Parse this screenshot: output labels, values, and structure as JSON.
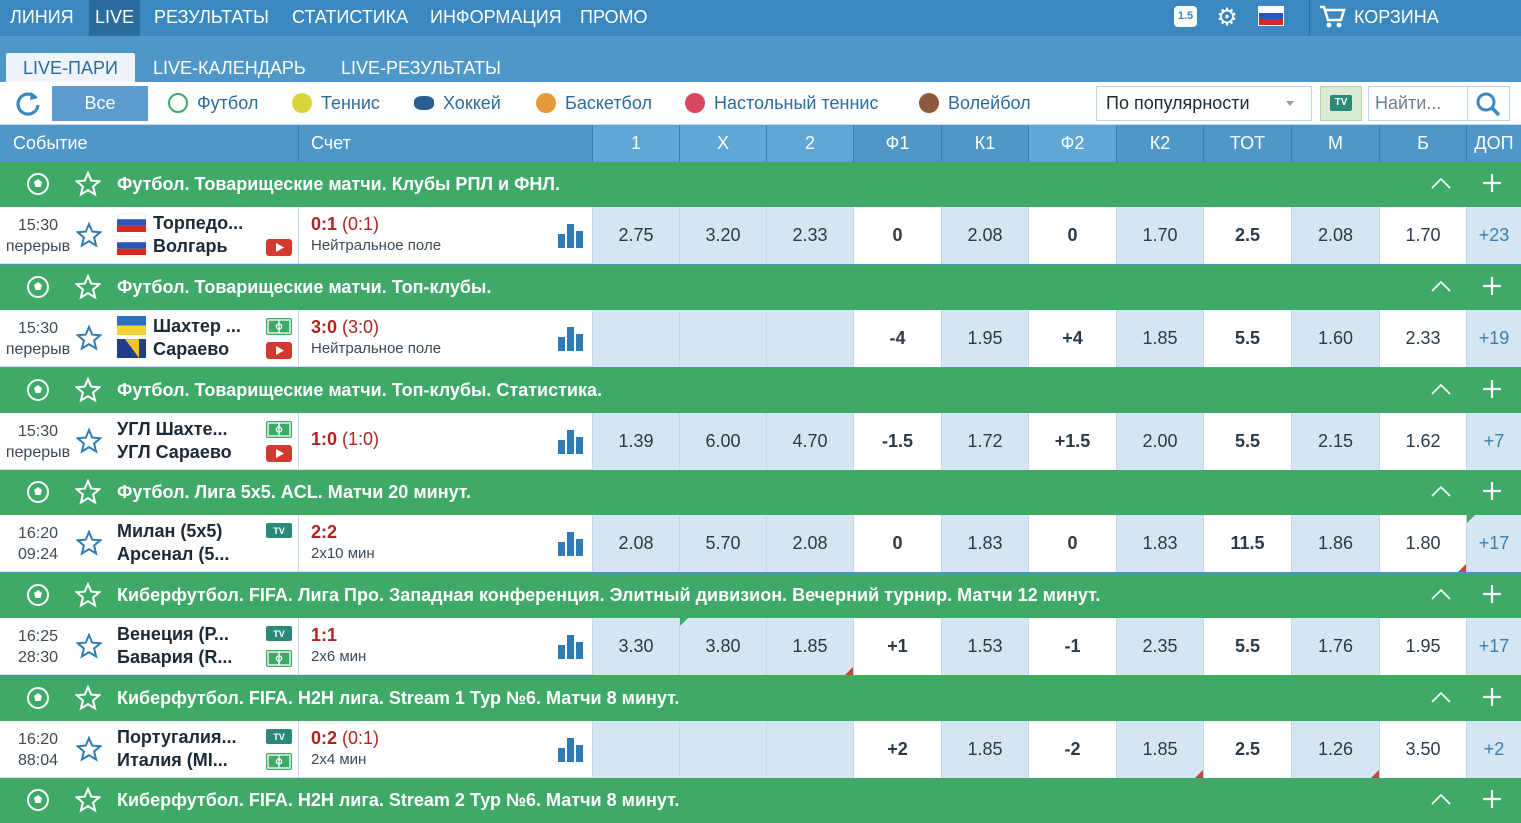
{
  "topnav": {
    "items": [
      "ЛИНИЯ",
      "LIVE",
      "РЕЗУЛЬТАТЫ",
      "СТАТИСТИКА",
      "ИНФОРМАЦИЯ",
      "ПРОМО"
    ],
    "active_index": 1,
    "version_badge": "1.5",
    "cart_label": "КОРЗИНА"
  },
  "subtabs": [
    "LIVE-ПАРИ",
    "LIVE-КАЛЕНДАРЬ",
    "LIVE-РЕЗУЛЬТАТЫ"
  ],
  "filters": {
    "all_label": "Все",
    "sports": [
      "Футбол",
      "Теннис",
      "Хоккей",
      "Баскетбол",
      "Настольный теннис",
      "Волейбол"
    ],
    "sort_value": "По популярности",
    "tv_label": "TV",
    "search_placeholder": "Найти..."
  },
  "header": {
    "event": "Событие",
    "score": "Счет",
    "cols": [
      "1",
      "X",
      "2",
      "Ф1",
      "К1",
      "Ф2",
      "К2",
      "ТОТ",
      "М",
      "Б",
      "ДОП"
    ]
  },
  "groups": [
    {
      "title": "Футбол. Товарищеские матчи. Клубы РПЛ и ФНЛ.",
      "match": {
        "time1": "15:30",
        "time2": "перерыв",
        "team1": "Торпедо...",
        "team2": "Волгарь",
        "flag1": "ru",
        "flag2": "ru",
        "icon1": "none",
        "icon2": "video",
        "score": "0:1",
        "score_half": "(0:1)",
        "note": "Нейтральное поле",
        "odds": [
          "2.75",
          "3.20",
          "2.33",
          "0",
          "2.08",
          "0",
          "1.70",
          "2.5",
          "2.08",
          "1.70",
          "+23"
        ]
      }
    },
    {
      "title": "Футбол. Товарищеские матчи. Топ-клубы.",
      "match": {
        "time1": "15:30",
        "time2": "перерыв",
        "team1": "Шахтер ...",
        "team2": "Сараево",
        "flag1": "ua",
        "flag2": "ba",
        "icon1": "field",
        "icon2": "video",
        "score": "3:0",
        "score_half": "(3:0)",
        "note": "Нейтральное поле",
        "odds": [
          "",
          "",
          "",
          "-4",
          "1.95",
          "+4",
          "1.85",
          "5.5",
          "1.60",
          "2.33",
          "+19"
        ]
      }
    },
    {
      "title": "Футбол. Товарищеские матчи. Топ-клубы. Статистика.",
      "match": {
        "time1": "15:30",
        "time2": "перерыв",
        "team1": "УГЛ Шахте...",
        "team2": "УГЛ Сараево",
        "flag1": "",
        "flag2": "",
        "icon1": "field",
        "icon2": "video",
        "score": "1:0",
        "score_half": "(1:0)",
        "note": "",
        "odds": [
          "1.39",
          "6.00",
          "4.70",
          "-1.5",
          "1.72",
          "+1.5",
          "2.00",
          "5.5",
          "2.15",
          "1.62",
          "+7"
        ]
      }
    },
    {
      "title": "Футбол. Лига 5х5. ACL. Матчи 20 минут.",
      "match": {
        "time1": "16:20",
        "time2": "09:24",
        "team1": "Милан (5х5)",
        "team2": "Арсенал (5...",
        "flag1": "",
        "flag2": "",
        "icon1": "tv",
        "icon2": "none",
        "score": "2:2",
        "score_half": "",
        "note": "2х10 мин",
        "odds": [
          "2.08",
          "5.70",
          "2.08",
          "0",
          "1.83",
          "0",
          "1.83",
          "11.5",
          "1.86",
          "1.80",
          "+17"
        ]
      }
    },
    {
      "title": "Киберфутбол. FIFA. Лига Про. Западная конференция. Элитный дивизион. Вечерний турнир. Матчи 12 минут.",
      "match": {
        "time1": "16:25",
        "time2": "28:30",
        "team1": "Венеция (Р...",
        "team2": "Бавария (R...",
        "flag1": "",
        "flag2": "",
        "icon1": "tv",
        "icon2": "field",
        "score": "1:1",
        "score_half": "",
        "note": "2х6 мин",
        "odds": [
          "3.30",
          "3.80",
          "1.85",
          "+1",
          "1.53",
          "-1",
          "2.35",
          "5.5",
          "1.76",
          "1.95",
          "+17"
        ]
      }
    },
    {
      "title": "Киберфутбол. FIFA. H2H лига. Stream 1 Тур №6. Матчи 8 минут.",
      "match": {
        "time1": "16:20",
        "time2": "88:04",
        "team1": "Португалия...",
        "team2": "Италия (MI...",
        "flag1": "",
        "flag2": "",
        "icon1": "tv",
        "icon2": "field",
        "score": "0:2",
        "score_half": "(0:1)",
        "note": "2х4 мин",
        "odds": [
          "",
          "",
          "",
          "+2",
          "1.85",
          "-2",
          "1.85",
          "2.5",
          "1.26",
          "3.50",
          "+2"
        ]
      }
    },
    {
      "title": "Киберфутбол. FIFA. H2H лига. Stream 2 Тур №6. Матчи 8 минут.",
      "match": null
    }
  ]
}
